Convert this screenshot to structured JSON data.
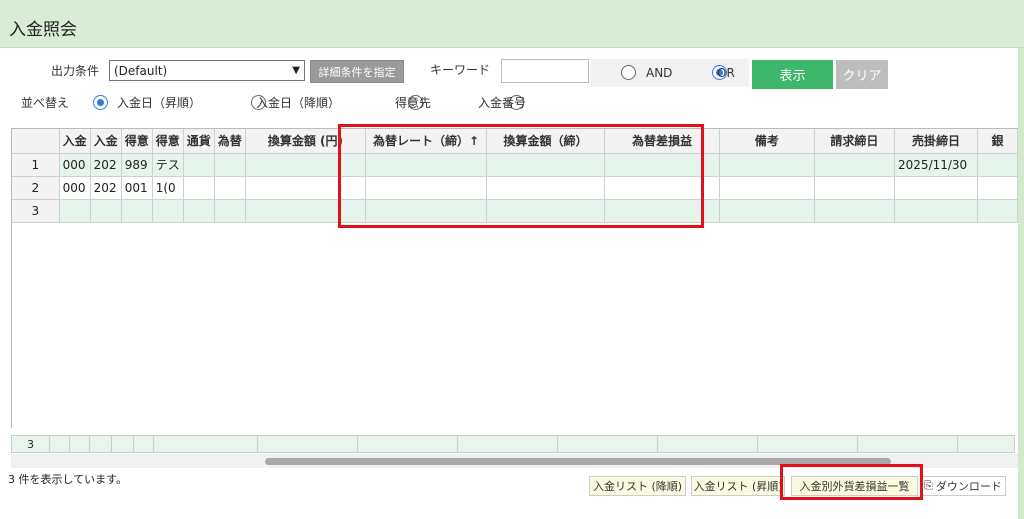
{
  "title": "入金照会",
  "filter": {
    "output_label": "出力条件",
    "output_value": "(Default)",
    "detail_button": "詳細条件を指定",
    "keyword_label": "キーワード",
    "keyword_value": "",
    "and_label": "AND",
    "or_label": "OR",
    "show_button": "表示",
    "clear_button": "クリア"
  },
  "sort": {
    "label": "並べ替え",
    "options": [
      "入金日（昇順）",
      "入金日（降順）",
      "得意先",
      "入金番号"
    ],
    "selected": 0
  },
  "table": {
    "headers": [
      "",
      "入金",
      "入金",
      "得意",
      "得意",
      "通貨",
      "為替",
      "換算金額 (円)",
      "為替レート（締）↑",
      "換算金額（締）",
      "為替差損益",
      "備考",
      "請求締日",
      "売掛締日",
      "銀"
    ],
    "rows": [
      [
        "1",
        "000",
        "202",
        "989",
        "テス",
        "",
        "",
        "",
        "",
        "",
        "",
        "",
        "",
        "2025/11/30",
        ""
      ],
      [
        "2",
        "000",
        "202",
        "001",
        "1(0",
        "",
        "",
        "",
        "",
        "",
        "",
        "",
        "",
        "",
        ""
      ],
      [
        "3",
        "",
        "",
        "",
        "",
        "",
        "",
        "",
        "",
        "",
        "",
        "",
        "",
        "",
        ""
      ]
    ],
    "footer_count": "3"
  },
  "status_text": "3 件を表示しています。",
  "footer_buttons": {
    "list_desc": "入金リスト (降順)",
    "list_asc": "入金リスト (昇順)",
    "fx_list": "入金別外貨差損益一覧",
    "download": "ダウンロード"
  }
}
